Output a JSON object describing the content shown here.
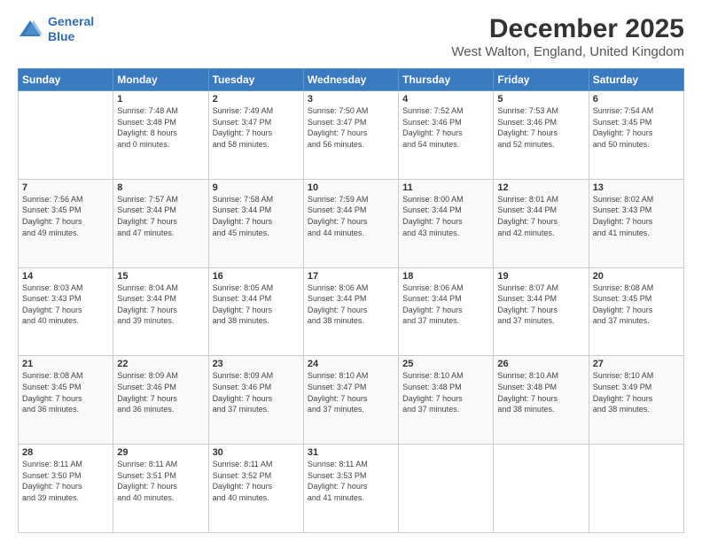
{
  "logo": {
    "line1": "General",
    "line2": "Blue"
  },
  "header": {
    "title": "December 2025",
    "subtitle": "West Walton, England, United Kingdom"
  },
  "days": [
    "Sunday",
    "Monday",
    "Tuesday",
    "Wednesday",
    "Thursday",
    "Friday",
    "Saturday"
  ],
  "weeks": [
    [
      {
        "day": "",
        "content": ""
      },
      {
        "day": "1",
        "content": "Sunrise: 7:48 AM\nSunset: 3:48 PM\nDaylight: 8 hours\nand 0 minutes."
      },
      {
        "day": "2",
        "content": "Sunrise: 7:49 AM\nSunset: 3:47 PM\nDaylight: 7 hours\nand 58 minutes."
      },
      {
        "day": "3",
        "content": "Sunrise: 7:50 AM\nSunset: 3:47 PM\nDaylight: 7 hours\nand 56 minutes."
      },
      {
        "day": "4",
        "content": "Sunrise: 7:52 AM\nSunset: 3:46 PM\nDaylight: 7 hours\nand 54 minutes."
      },
      {
        "day": "5",
        "content": "Sunrise: 7:53 AM\nSunset: 3:46 PM\nDaylight: 7 hours\nand 52 minutes."
      },
      {
        "day": "6",
        "content": "Sunrise: 7:54 AM\nSunset: 3:45 PM\nDaylight: 7 hours\nand 50 minutes."
      }
    ],
    [
      {
        "day": "7",
        "content": "Sunrise: 7:56 AM\nSunset: 3:45 PM\nDaylight: 7 hours\nand 49 minutes."
      },
      {
        "day": "8",
        "content": "Sunrise: 7:57 AM\nSunset: 3:44 PM\nDaylight: 7 hours\nand 47 minutes."
      },
      {
        "day": "9",
        "content": "Sunrise: 7:58 AM\nSunset: 3:44 PM\nDaylight: 7 hours\nand 45 minutes."
      },
      {
        "day": "10",
        "content": "Sunrise: 7:59 AM\nSunset: 3:44 PM\nDaylight: 7 hours\nand 44 minutes."
      },
      {
        "day": "11",
        "content": "Sunrise: 8:00 AM\nSunset: 3:44 PM\nDaylight: 7 hours\nand 43 minutes."
      },
      {
        "day": "12",
        "content": "Sunrise: 8:01 AM\nSunset: 3:44 PM\nDaylight: 7 hours\nand 42 minutes."
      },
      {
        "day": "13",
        "content": "Sunrise: 8:02 AM\nSunset: 3:43 PM\nDaylight: 7 hours\nand 41 minutes."
      }
    ],
    [
      {
        "day": "14",
        "content": "Sunrise: 8:03 AM\nSunset: 3:43 PM\nDaylight: 7 hours\nand 40 minutes."
      },
      {
        "day": "15",
        "content": "Sunrise: 8:04 AM\nSunset: 3:44 PM\nDaylight: 7 hours\nand 39 minutes."
      },
      {
        "day": "16",
        "content": "Sunrise: 8:05 AM\nSunset: 3:44 PM\nDaylight: 7 hours\nand 38 minutes."
      },
      {
        "day": "17",
        "content": "Sunrise: 8:06 AM\nSunset: 3:44 PM\nDaylight: 7 hours\nand 38 minutes."
      },
      {
        "day": "18",
        "content": "Sunrise: 8:06 AM\nSunset: 3:44 PM\nDaylight: 7 hours\nand 37 minutes."
      },
      {
        "day": "19",
        "content": "Sunrise: 8:07 AM\nSunset: 3:44 PM\nDaylight: 7 hours\nand 37 minutes."
      },
      {
        "day": "20",
        "content": "Sunrise: 8:08 AM\nSunset: 3:45 PM\nDaylight: 7 hours\nand 37 minutes."
      }
    ],
    [
      {
        "day": "21",
        "content": "Sunrise: 8:08 AM\nSunset: 3:45 PM\nDaylight: 7 hours\nand 36 minutes."
      },
      {
        "day": "22",
        "content": "Sunrise: 8:09 AM\nSunset: 3:46 PM\nDaylight: 7 hours\nand 36 minutes."
      },
      {
        "day": "23",
        "content": "Sunrise: 8:09 AM\nSunset: 3:46 PM\nDaylight: 7 hours\nand 37 minutes."
      },
      {
        "day": "24",
        "content": "Sunrise: 8:10 AM\nSunset: 3:47 PM\nDaylight: 7 hours\nand 37 minutes."
      },
      {
        "day": "25",
        "content": "Sunrise: 8:10 AM\nSunset: 3:48 PM\nDaylight: 7 hours\nand 37 minutes."
      },
      {
        "day": "26",
        "content": "Sunrise: 8:10 AM\nSunset: 3:48 PM\nDaylight: 7 hours\nand 38 minutes."
      },
      {
        "day": "27",
        "content": "Sunrise: 8:10 AM\nSunset: 3:49 PM\nDaylight: 7 hours\nand 38 minutes."
      }
    ],
    [
      {
        "day": "28",
        "content": "Sunrise: 8:11 AM\nSunset: 3:50 PM\nDaylight: 7 hours\nand 39 minutes."
      },
      {
        "day": "29",
        "content": "Sunrise: 8:11 AM\nSunset: 3:51 PM\nDaylight: 7 hours\nand 40 minutes."
      },
      {
        "day": "30",
        "content": "Sunrise: 8:11 AM\nSunset: 3:52 PM\nDaylight: 7 hours\nand 40 minutes."
      },
      {
        "day": "31",
        "content": "Sunrise: 8:11 AM\nSunset: 3:53 PM\nDaylight: 7 hours\nand 41 minutes."
      },
      {
        "day": "",
        "content": ""
      },
      {
        "day": "",
        "content": ""
      },
      {
        "day": "",
        "content": ""
      }
    ]
  ]
}
